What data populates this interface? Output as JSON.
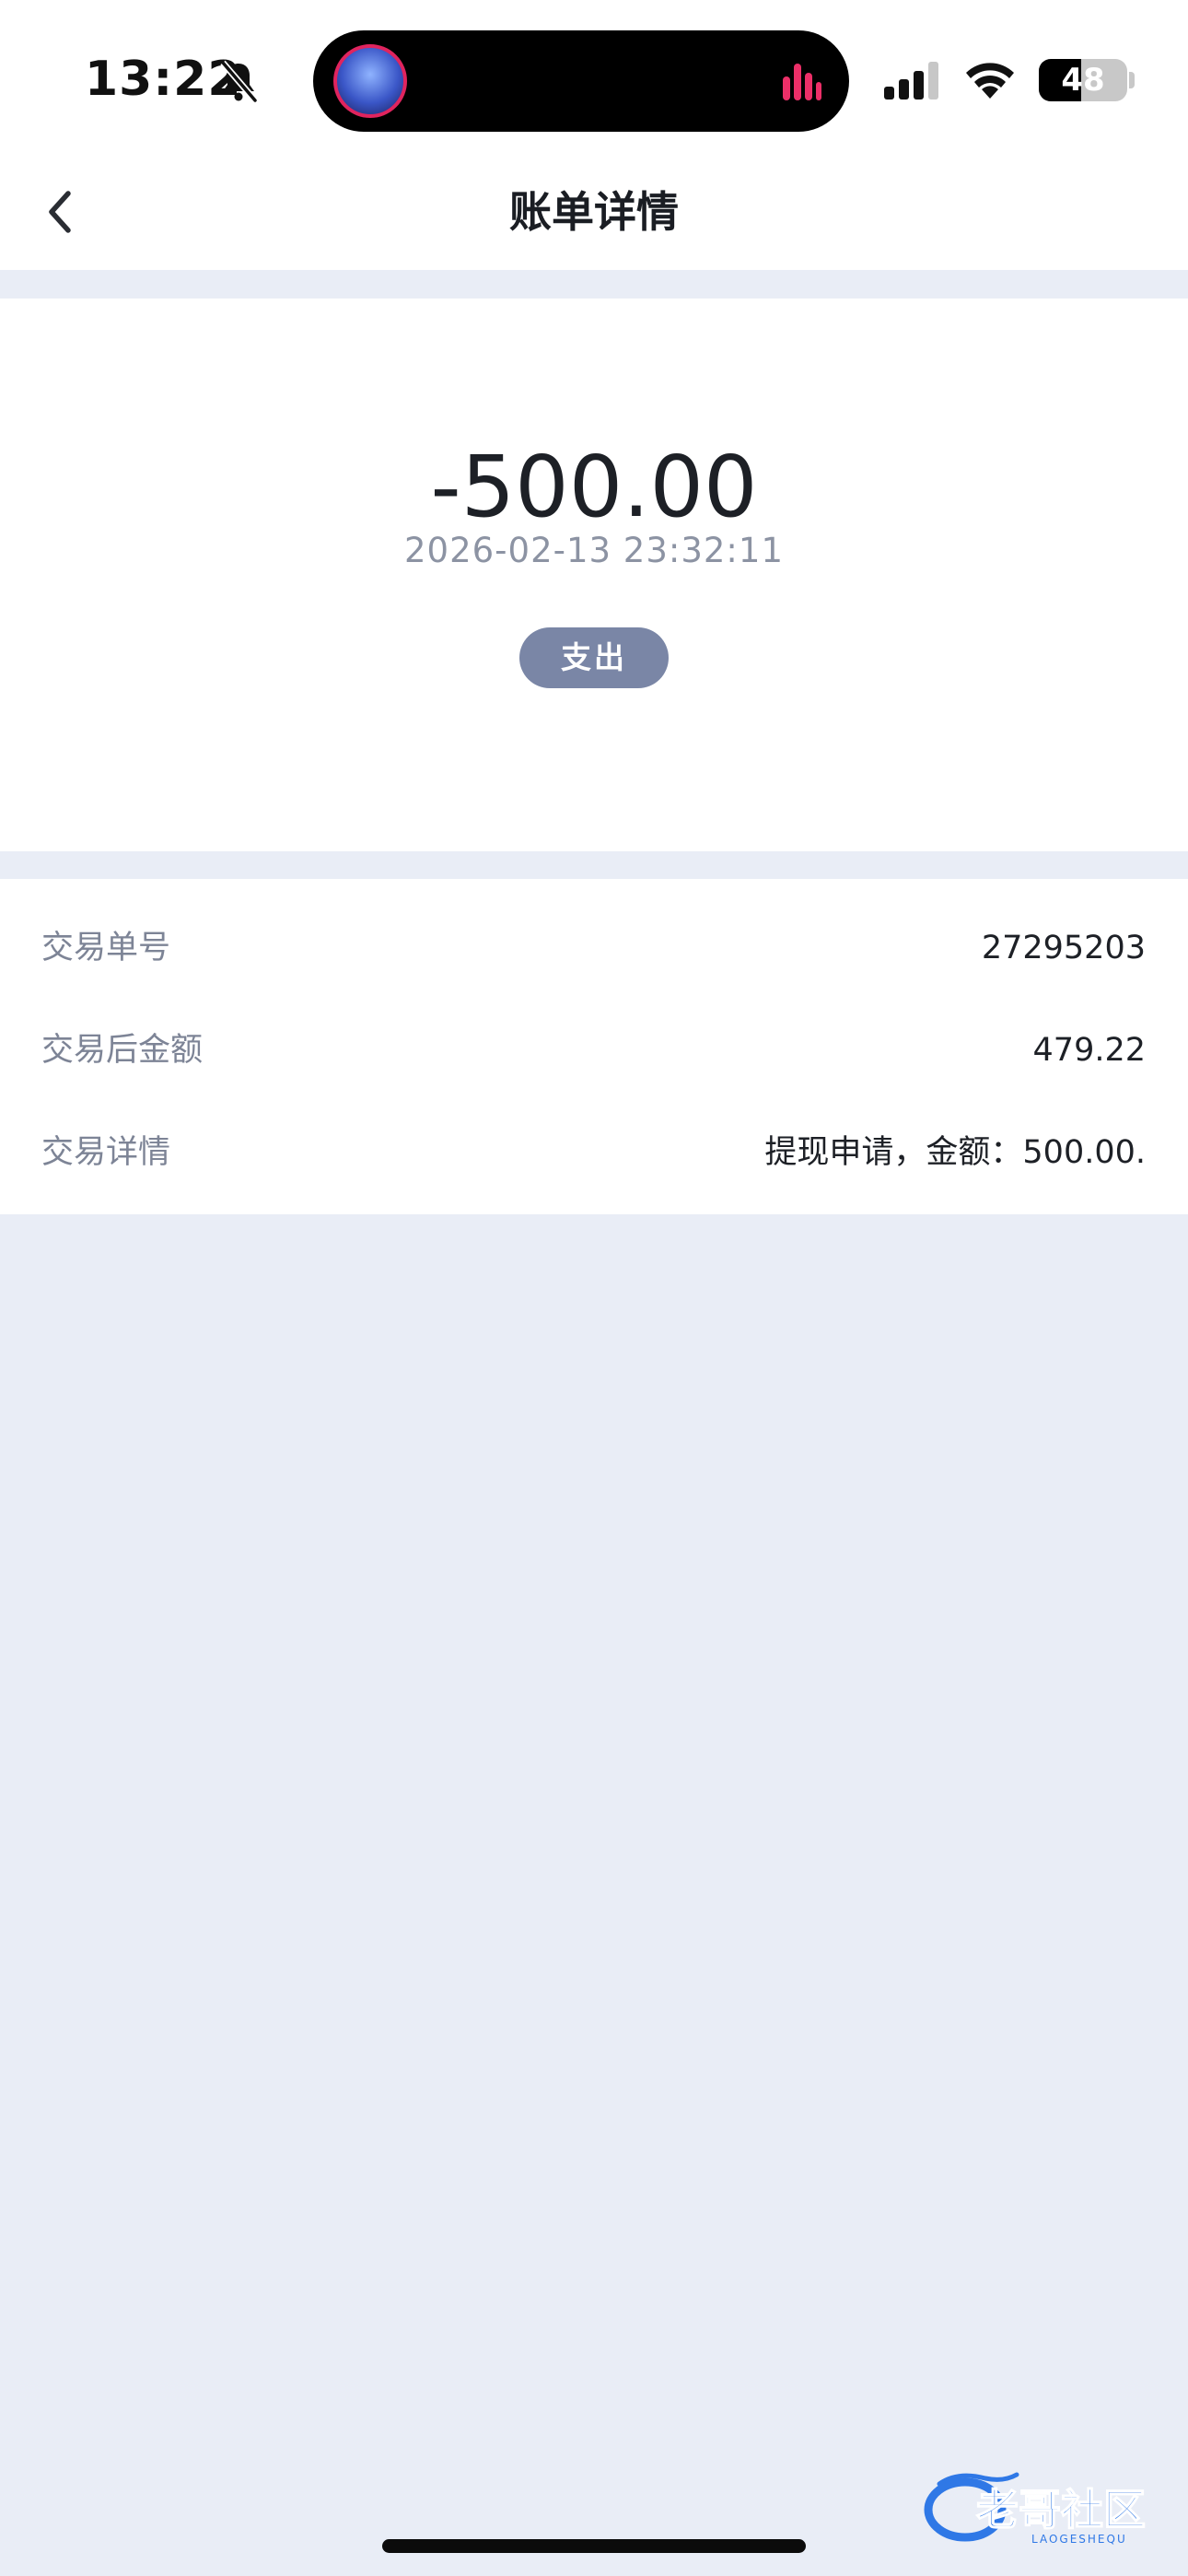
{
  "status_bar": {
    "time": "13:22",
    "battery_level": "48",
    "battery_fraction": 0.48,
    "icons": [
      "bell-muted-icon",
      "signal-icon",
      "wifi-icon",
      "battery-icon"
    ]
  },
  "header": {
    "title": "账单详情",
    "back_icon": "chevron-left-icon"
  },
  "summary": {
    "amount": "-500.00",
    "datetime": "2026-02-13 23:32:11",
    "type_badge": "支出"
  },
  "details": [
    {
      "label": "交易单号",
      "value": "27295203"
    },
    {
      "label": "交易后金额",
      "value": "479.22"
    },
    {
      "label": "交易详情",
      "value": "提现申请，金额：500.00."
    }
  ],
  "watermark": {
    "text": "老哥社区",
    "subtext": "LAOGESHEQU"
  },
  "colors": {
    "background": "#e9edf6",
    "card": "#ffffff",
    "badge": "#7a86a6",
    "label": "#7d8496",
    "accent_pink": "#e0245e",
    "watermark_blue": "#2f78e6"
  }
}
